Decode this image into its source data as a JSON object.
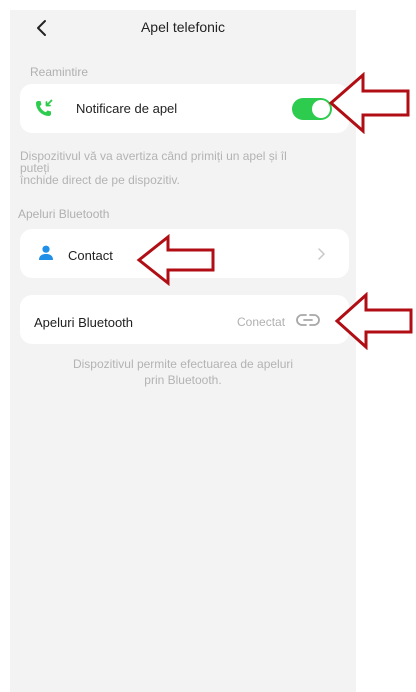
{
  "header": {
    "title": "Apel telefonic",
    "back_icon": "chevron-left-icon"
  },
  "reminder": {
    "section_label": "Reamintire",
    "notification_label": "Notificare de apel",
    "notification_icon": "incoming-call-icon",
    "toggle_on": true,
    "description_line1": "Dispozitivul vă va avertiza când primiți un apel și îl",
    "description_line2": "puteți",
    "description_line3": "închide direct de pe dispozitiv."
  },
  "bluetooth_calls": {
    "section_label": "Apeluri Bluetooth",
    "contact_label": "Contact",
    "contact_icon": "person-icon",
    "bt_label": "Apeluri Bluetooth",
    "bt_status": "Conectat",
    "bt_status_icon": "link-icon",
    "description_line1": "Dispozitivul permite efectuarea de apeluri",
    "description_line2": "prin Bluetooth."
  },
  "colors": {
    "background": "#f3f3f3",
    "card": "#ffffff",
    "toggle_on": "#2ecc4e",
    "call_icon": "#2ecc4e",
    "contact_icon": "#1f8fe8",
    "annotation_arrow": "#b00e14"
  }
}
